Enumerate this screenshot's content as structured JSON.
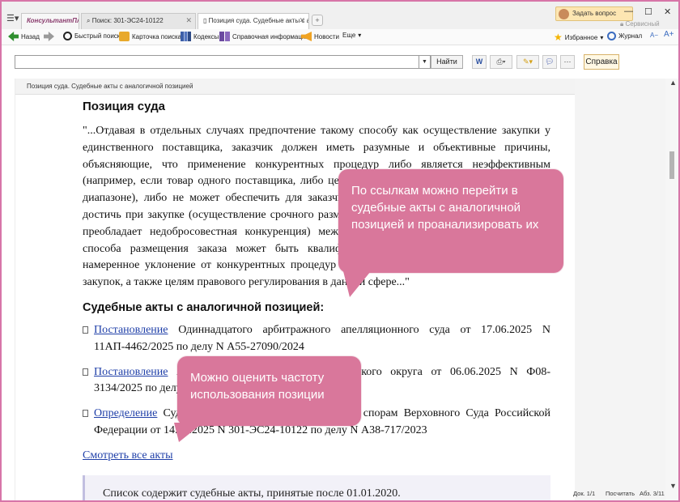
{
  "tabs": {
    "logo": "КонсультантПлюс",
    "search": "Поиск: 301-ЭС24-10122",
    "active": "Позиция суда. Судебные акты с анало..."
  },
  "header": {
    "ask_button": "Задать вопрос",
    "service_center": "Сервисный центр"
  },
  "toolbar": {
    "back": "Назад",
    "quick_search": "Быстрый поиск",
    "search_card": "Карточка поиска",
    "codes": "Кодексы",
    "reference": "Справочная информация",
    "news": "Новости",
    "more": "Еще",
    "favorites": "Избранное",
    "journal": "Журнал",
    "font_minus": "A−",
    "font_plus": "A+"
  },
  "search": {
    "value": "",
    "find_button": "Найти",
    "help_button": "Справка"
  },
  "document": {
    "breadcrumb": "Позиция суда. Судебные акты с аналогичной позицией",
    "title": "Позиция суда",
    "quote": "\"...Отдавая в отдельных случаях предпочтение такому способу как осуществление закупки у единственного поставщика, заказчик должен иметь разумные и объективные причины, объясняющие, что применение конкурентных процедур либо является неэффективным (например, если товар одного поставщика, либо цены на объект закупки колеблются в узком диапазоне), либо не может обеспечить для заказчика того результата, которого он намерен достичь при закупке (осуществление срочного размещения заказа). В противном случае, если преобладает недобросовестная конкуренция) между участниками, выбор неконкурентного способа размещения заказа может быть квалифицирован как злоупотребление правом, намеренное уклонение от конкурентных процедур в обход публичных целей осуществления закупок, а также целям правового регулирования в данной сфере...\"",
    "acts_title": "Судебные акты с аналогичной позицией:",
    "acts": [
      {
        "link": "Постановление",
        "text": " Одиннадцатого арбитражного апелляционного суда от 17.06.2025 N 11АП-4462/2025 по делу N А55-27090/2024"
      },
      {
        "link": "Постановление",
        "text": " Арбитражного суда Северо-Кавказского округа от 06.06.2025 N Ф08-3134/2025 по делу N А32-14221/2024"
      },
      {
        "link": "Определение",
        "text": " Судебной коллегии по экономическим спорам Верховного Суда Российской Федерации от 14.05.2025 N 301-ЭС24-10122 по делу N А38-717/2023"
      }
    ],
    "see_all": "Смотреть все акты",
    "note": "Список содержит судебные акты, принятые после 01.01.2020."
  },
  "status": {
    "doc": "Док. 1/1",
    "count": "Посчитать",
    "para": "Абз. 3/11"
  },
  "callouts": {
    "links": "По ссылкам можно перейти в судебные акты с аналогичной позицией и проанализировать их",
    "frequency": "Можно оценить частоту использования позиции"
  }
}
